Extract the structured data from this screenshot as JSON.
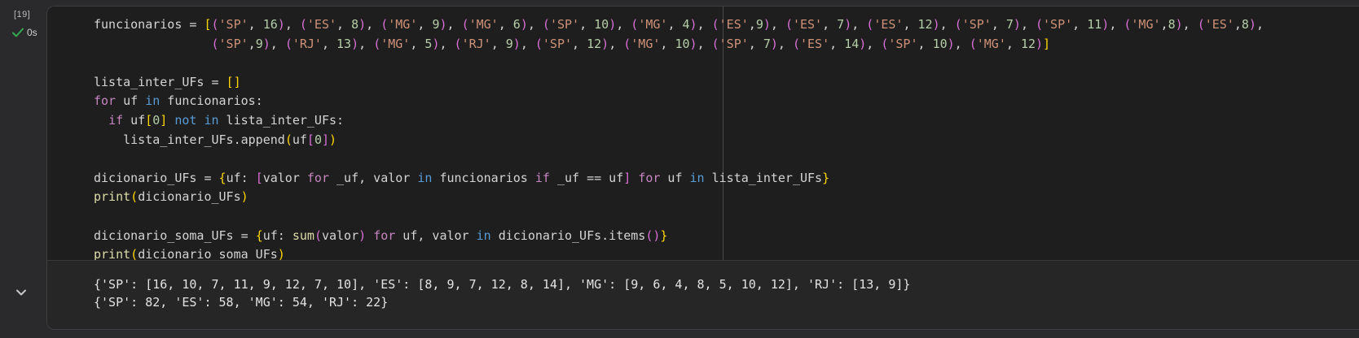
{
  "cell": {
    "execution_count": "[19]",
    "status_time": "0s",
    "icons": {
      "status": "check-icon",
      "collapse": "chevron-down-icon"
    },
    "colors": {
      "status": "#34a853",
      "string": "#ce9178",
      "number": "#b5cea8",
      "keyword": "#c586c0",
      "operator": "#569cd6",
      "function": "#dcdcaa"
    }
  },
  "code_lines": [
    [
      [
        "funcionarios = ",
        "plain"
      ],
      [
        "[",
        "br1"
      ],
      [
        "(",
        "br2"
      ],
      [
        "'SP'",
        "str"
      ],
      [
        ", ",
        "plain"
      ],
      [
        "16",
        "num"
      ],
      [
        ")",
        "br2"
      ],
      [
        ", ",
        "plain"
      ],
      [
        "(",
        "br2"
      ],
      [
        "'ES'",
        "str"
      ],
      [
        ", ",
        "plain"
      ],
      [
        "8",
        "num"
      ],
      [
        ")",
        "br2"
      ],
      [
        ", ",
        "plain"
      ],
      [
        "(",
        "br2"
      ],
      [
        "'MG'",
        "str"
      ],
      [
        ", ",
        "plain"
      ],
      [
        "9",
        "num"
      ],
      [
        ")",
        "br2"
      ],
      [
        ", ",
        "plain"
      ],
      [
        "(",
        "br2"
      ],
      [
        "'MG'",
        "str"
      ],
      [
        ", ",
        "plain"
      ],
      [
        "6",
        "num"
      ],
      [
        ")",
        "br2"
      ],
      [
        ", ",
        "plain"
      ],
      [
        "(",
        "br2"
      ],
      [
        "'SP'",
        "str"
      ],
      [
        ", ",
        "plain"
      ],
      [
        "10",
        "num"
      ],
      [
        ")",
        "br2"
      ],
      [
        ", ",
        "plain"
      ],
      [
        "(",
        "br2"
      ],
      [
        "'MG'",
        "str"
      ],
      [
        ", ",
        "plain"
      ],
      [
        "4",
        "num"
      ],
      [
        ")",
        "br2"
      ],
      [
        ", ",
        "plain"
      ],
      [
        "(",
        "br2"
      ],
      [
        "'ES'",
        "str"
      ],
      [
        ",",
        "plain"
      ],
      [
        "9",
        "num"
      ],
      [
        ")",
        "br2"
      ],
      [
        ", ",
        "plain"
      ],
      [
        "(",
        "br2"
      ],
      [
        "'ES'",
        "str"
      ],
      [
        ", ",
        "plain"
      ],
      [
        "7",
        "num"
      ],
      [
        ")",
        "br2"
      ],
      [
        ", ",
        "plain"
      ],
      [
        "(",
        "br2"
      ],
      [
        "'ES'",
        "str"
      ],
      [
        ", ",
        "plain"
      ],
      [
        "12",
        "num"
      ],
      [
        ")",
        "br2"
      ],
      [
        ", ",
        "plain"
      ],
      [
        "(",
        "br2"
      ],
      [
        "'SP'",
        "str"
      ],
      [
        ", ",
        "plain"
      ],
      [
        "7",
        "num"
      ],
      [
        ")",
        "br2"
      ],
      [
        ", ",
        "plain"
      ],
      [
        "(",
        "br2"
      ],
      [
        "'SP'",
        "str"
      ],
      [
        ", ",
        "plain"
      ],
      [
        "11",
        "num"
      ],
      [
        ")",
        "br2"
      ],
      [
        ", ",
        "plain"
      ],
      [
        "(",
        "br2"
      ],
      [
        "'MG'",
        "str"
      ],
      [
        ",",
        "plain"
      ],
      [
        "8",
        "num"
      ],
      [
        ")",
        "br2"
      ],
      [
        ", ",
        "plain"
      ],
      [
        "(",
        "br2"
      ],
      [
        "'ES'",
        "str"
      ],
      [
        ",",
        "plain"
      ],
      [
        "8",
        "num"
      ],
      [
        ")",
        "br2"
      ],
      [
        ",",
        "plain"
      ]
    ],
    [
      [
        "                ",
        "plain"
      ],
      [
        "(",
        "br2"
      ],
      [
        "'SP'",
        "str"
      ],
      [
        ",",
        "plain"
      ],
      [
        "9",
        "num"
      ],
      [
        ")",
        "br2"
      ],
      [
        ", ",
        "plain"
      ],
      [
        "(",
        "br2"
      ],
      [
        "'RJ'",
        "str"
      ],
      [
        ", ",
        "plain"
      ],
      [
        "13",
        "num"
      ],
      [
        ")",
        "br2"
      ],
      [
        ", ",
        "plain"
      ],
      [
        "(",
        "br2"
      ],
      [
        "'MG'",
        "str"
      ],
      [
        ", ",
        "plain"
      ],
      [
        "5",
        "num"
      ],
      [
        ")",
        "br2"
      ],
      [
        ", ",
        "plain"
      ],
      [
        "(",
        "br2"
      ],
      [
        "'RJ'",
        "str"
      ],
      [
        ", ",
        "plain"
      ],
      [
        "9",
        "num"
      ],
      [
        ")",
        "br2"
      ],
      [
        ", ",
        "plain"
      ],
      [
        "(",
        "br2"
      ],
      [
        "'SP'",
        "str"
      ],
      [
        ", ",
        "plain"
      ],
      [
        "12",
        "num"
      ],
      [
        ")",
        "br2"
      ],
      [
        ", ",
        "plain"
      ],
      [
        "(",
        "br2"
      ],
      [
        "'MG'",
        "str"
      ],
      [
        ", ",
        "plain"
      ],
      [
        "10",
        "num"
      ],
      [
        ")",
        "br2"
      ],
      [
        ", ",
        "plain"
      ],
      [
        "(",
        "br2"
      ],
      [
        "'SP'",
        "str"
      ],
      [
        ", ",
        "plain"
      ],
      [
        "7",
        "num"
      ],
      [
        ")",
        "br2"
      ],
      [
        ", ",
        "plain"
      ],
      [
        "(",
        "br2"
      ],
      [
        "'ES'",
        "str"
      ],
      [
        ", ",
        "plain"
      ],
      [
        "14",
        "num"
      ],
      [
        ")",
        "br2"
      ],
      [
        ", ",
        "plain"
      ],
      [
        "(",
        "br2"
      ],
      [
        "'SP'",
        "str"
      ],
      [
        ", ",
        "plain"
      ],
      [
        "10",
        "num"
      ],
      [
        ")",
        "br2"
      ],
      [
        ", ",
        "plain"
      ],
      [
        "(",
        "br2"
      ],
      [
        "'MG'",
        "str"
      ],
      [
        ", ",
        "plain"
      ],
      [
        "12",
        "num"
      ],
      [
        ")",
        "br2"
      ],
      [
        "]",
        "br1"
      ]
    ],
    [],
    [
      [
        "lista_inter_UFs = ",
        "plain"
      ],
      [
        "[]",
        "br1"
      ]
    ],
    [
      [
        "for",
        "kw"
      ],
      [
        " uf ",
        "plain"
      ],
      [
        "in",
        "op"
      ],
      [
        " funcionarios:",
        "plain"
      ]
    ],
    [
      [
        "  ",
        "plain"
      ],
      [
        "if",
        "kw"
      ],
      [
        " uf",
        "plain"
      ],
      [
        "[",
        "br1"
      ],
      [
        "0",
        "num"
      ],
      [
        "]",
        "br1"
      ],
      [
        " ",
        "plain"
      ],
      [
        "not",
        "op"
      ],
      [
        " ",
        "plain"
      ],
      [
        "in",
        "op"
      ],
      [
        " lista_inter_UFs:",
        "plain"
      ]
    ],
    [
      [
        "    lista_inter_UFs.append",
        "plain"
      ],
      [
        "(",
        "br1"
      ],
      [
        "uf",
        "plain"
      ],
      [
        "[",
        "br2"
      ],
      [
        "0",
        "num"
      ],
      [
        "]",
        "br2"
      ],
      [
        ")",
        "br1"
      ]
    ],
    [],
    [
      [
        "dicionario_UFs = ",
        "plain"
      ],
      [
        "{",
        "br1"
      ],
      [
        "uf: ",
        "plain"
      ],
      [
        "[",
        "br2"
      ],
      [
        "valor ",
        "plain"
      ],
      [
        "for",
        "kw"
      ],
      [
        " _uf, valor ",
        "plain"
      ],
      [
        "in",
        "op"
      ],
      [
        " funcionarios ",
        "plain"
      ],
      [
        "if",
        "kw"
      ],
      [
        " _uf == uf",
        "plain"
      ],
      [
        "]",
        "br2"
      ],
      [
        " ",
        "plain"
      ],
      [
        "for",
        "kw"
      ],
      [
        " uf ",
        "plain"
      ],
      [
        "in",
        "op"
      ],
      [
        " lista_inter_UFs",
        "plain"
      ],
      [
        "}",
        "br1"
      ]
    ],
    [
      [
        "print",
        "fn"
      ],
      [
        "(",
        "br1"
      ],
      [
        "dicionario_UFs",
        "plain"
      ],
      [
        ")",
        "br1"
      ]
    ],
    [],
    [
      [
        "dicionario_soma_UFs = ",
        "plain"
      ],
      [
        "{",
        "br1"
      ],
      [
        "uf: ",
        "plain"
      ],
      [
        "sum",
        "fn"
      ],
      [
        "(",
        "br2"
      ],
      [
        "valor",
        "plain"
      ],
      [
        ")",
        "br2"
      ],
      [
        " ",
        "plain"
      ],
      [
        "for",
        "kw"
      ],
      [
        " uf, valor ",
        "plain"
      ],
      [
        "in",
        "op"
      ],
      [
        " dicionario_UFs.items",
        "plain"
      ],
      [
        "()",
        "br2"
      ],
      [
        "}",
        "br1"
      ]
    ],
    [
      [
        "print",
        "fn"
      ],
      [
        "(",
        "br1"
      ],
      [
        "dicionario_soma_UFs",
        "plain"
      ],
      [
        ")",
        "br1"
      ]
    ]
  ],
  "output_lines": [
    "{'SP': [16, 10, 7, 11, 9, 12, 7, 10], 'ES': [8, 9, 7, 12, 8, 14], 'MG': [9, 6, 4, 8, 5, 10, 12], 'RJ': [13, 9]}",
    "{'SP': 82, 'ES': 58, 'MG': 54, 'RJ': 22}"
  ]
}
